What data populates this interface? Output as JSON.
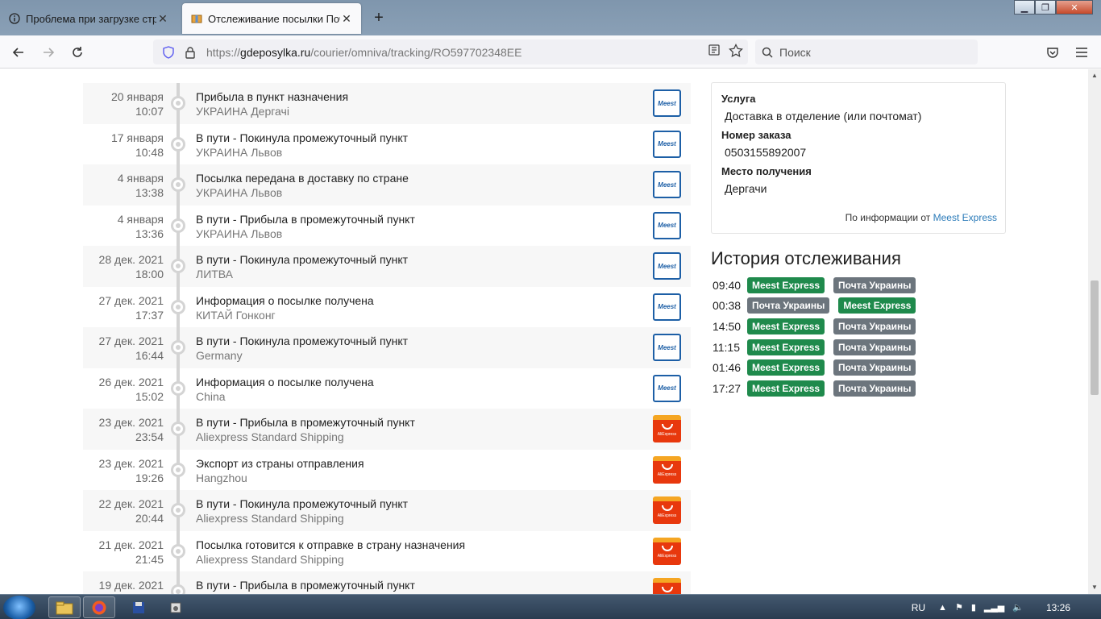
{
  "browser": {
    "tabs": [
      {
        "title": "Проблема при загрузке стран",
        "active": false,
        "icon": "info-icon"
      },
      {
        "title": "Отслеживание посылки Почт",
        "active": true,
        "icon": "package-icon"
      }
    ],
    "url_scheme": "https://",
    "url_host": "gdeposylka.ru",
    "url_path": "/courier/omniva/tracking/RO597702348EE",
    "search_placeholder": "Поиск"
  },
  "tracking": {
    "events": [
      {
        "date": "20 января",
        "time": "10:07",
        "status": "Прибыла в пункт назначения",
        "location": "УКРАИНА Дергачі",
        "carrier": "meest"
      },
      {
        "date": "17 января",
        "time": "10:48",
        "status": "В пути - Покинула промежуточный пункт",
        "location": "УКРАИНА Львов",
        "carrier": "meest"
      },
      {
        "date": "4 января",
        "time": "13:38",
        "status": "Посылка передана в доставку по стране",
        "location": "УКРАИНА Львов",
        "carrier": "meest"
      },
      {
        "date": "4 января",
        "time": "13:36",
        "status": "В пути - Прибыла в промежуточный пункт",
        "location": "УКРАИНА Львов",
        "carrier": "meest"
      },
      {
        "date": "28 дек. 2021",
        "time": "18:00",
        "status": "В пути - Покинула промежуточный пункт",
        "location": "ЛИТВА",
        "carrier": "meest"
      },
      {
        "date": "27 дек. 2021",
        "time": "17:37",
        "status": "Информация о посылке получена",
        "location": "КИТАЙ Гонконг",
        "carrier": "meest"
      },
      {
        "date": "27 дек. 2021",
        "time": "16:44",
        "status": "В пути - Покинула промежуточный пункт",
        "location": "Germany",
        "carrier": "meest"
      },
      {
        "date": "26 дек. 2021",
        "time": "15:02",
        "status": "Информация о посылке получена",
        "location": "China",
        "carrier": "meest"
      },
      {
        "date": "23 дек. 2021",
        "time": "23:54",
        "status": "В пути - Прибыла в промежуточный пункт",
        "location": "Aliexpress Standard Shipping",
        "carrier": "ali"
      },
      {
        "date": "23 дек. 2021",
        "time": "19:26",
        "status": "Экспорт из страны отправления",
        "location": "Hangzhou",
        "carrier": "ali"
      },
      {
        "date": "22 дек. 2021",
        "time": "20:44",
        "status": "В пути - Покинула промежуточный пункт",
        "location": "Aliexpress Standard Shipping",
        "carrier": "ali"
      },
      {
        "date": "21 дек. 2021",
        "time": "21:45",
        "status": "Посылка готовится к отправке в страну назначения",
        "location": "Aliexpress Standard Shipping",
        "carrier": "ali"
      },
      {
        "date": "19 дек. 2021",
        "time": "",
        "status": "В пути - Прибыла в промежуточный пункт",
        "location": "",
        "carrier": "ali"
      }
    ],
    "meest_logo_text": "Meest",
    "ali_logo_text": "AliExpress"
  },
  "info": {
    "service_label": "Услуга",
    "service_value": "Доставка в отделение (или почтомат)",
    "order_label": "Номер заказа",
    "order_value": "0503155892007",
    "place_label": "Место получения",
    "place_value": "Дергачи",
    "source_prefix": "По информации от",
    "source_link": "Meest Express"
  },
  "history": {
    "title": "История отслеживания",
    "rows": [
      {
        "time": "09:40",
        "badges": [
          {
            "text": "Meest Express",
            "color": "green"
          },
          {
            "text": "Почта Украины",
            "color": "gray"
          }
        ]
      },
      {
        "time": "00:38",
        "badges": [
          {
            "text": "Почта Украины",
            "color": "gray"
          },
          {
            "text": "Meest Express",
            "color": "green"
          }
        ]
      },
      {
        "time": "14:50",
        "badges": [
          {
            "text": "Meest Express",
            "color": "green"
          },
          {
            "text": "Почта Украины",
            "color": "gray"
          }
        ]
      },
      {
        "time": "11:15",
        "badges": [
          {
            "text": "Meest Express",
            "color": "green"
          },
          {
            "text": "Почта Украины",
            "color": "gray"
          }
        ]
      },
      {
        "time": "01:46",
        "badges": [
          {
            "text": "Meest Express",
            "color": "green"
          },
          {
            "text": "Почта Украины",
            "color": "gray"
          }
        ]
      },
      {
        "time": "17:27",
        "badges": [
          {
            "text": "Meest Express",
            "color": "green"
          },
          {
            "text": "Почта Украины",
            "color": "gray"
          }
        ]
      }
    ]
  },
  "taskbar": {
    "lang": "RU",
    "clock": "13:26"
  }
}
